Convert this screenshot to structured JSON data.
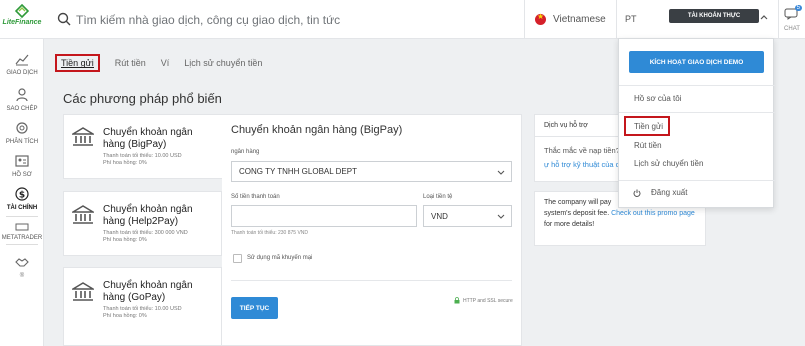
{
  "brand": {
    "name": "LiteFinance",
    "color": "#2f9a3a"
  },
  "search": {
    "placeholder": "Tìm kiếm nhà giao dịch, công cụ giao dịch, tin tức"
  },
  "header": {
    "language": "Vietnamese",
    "user_initials": "PT",
    "account_type": "TÀI KHOẢN THỰC",
    "chat_label": "CHAT",
    "chat_badge": "5"
  },
  "sidebar": {
    "items": [
      {
        "label": "GIAO DỊCH",
        "icon": "chart-icon"
      },
      {
        "label": "SAO CHÉP",
        "icon": "copy-trader-icon"
      },
      {
        "label": "PHÂN TÍCH",
        "icon": "analysis-icon"
      },
      {
        "label": "HỒ SƠ",
        "icon": "profile-icon"
      },
      {
        "label": "TÀI CHÍNH",
        "icon": "dollar-icon"
      },
      {
        "label": "METATRADER",
        "icon": "metatrader-icon"
      },
      {
        "label": "",
        "icon": "handshake-icon"
      }
    ]
  },
  "tabs": [
    {
      "label": "Tiền gửi",
      "active": true
    },
    {
      "label": "Rút tiền",
      "active": false
    },
    {
      "label": "Ví",
      "active": false
    },
    {
      "label": "Lịch sử chuyển tiền",
      "active": false
    }
  ],
  "section_title": "Các phương pháp phổ biến",
  "methods": [
    {
      "name": "Chuyển khoản ngân hàng (BigPay)",
      "min": "Thanh toán tối thiểu: 10.00 USD",
      "fee": "Phí hoa hồng: 0%"
    },
    {
      "name": "Chuyển khoản ngân hàng (Help2Pay)",
      "min": "Thanh toán tối thiểu: 300 000 VND",
      "fee": "Phí hoa hồng: 0%"
    },
    {
      "name": "Chuyển khoản ngân hàng (GoPay)",
      "min": "Thanh toán tối thiểu: 10.00 USD",
      "fee": "Phí hoa hồng: 0%"
    }
  ],
  "form": {
    "title": "Chuyển khoản ngân hàng (BigPay)",
    "bank_label": "ngân hàng",
    "bank_value": "CONG TY TNHH GLOBAL DEPT",
    "amount_label": "Số tiền thanh toán",
    "amount_value": "",
    "amount_hint": "Thanh toán tối thiểu: 230 875 VND",
    "currency_label": "Loại tiền tệ",
    "currency_value": "VND",
    "promo_label": "Sử dụng mã khuyến mại",
    "continue_label": "TIẾP TỤC",
    "secure_label": "HTTP and SSL secure"
  },
  "support": {
    "title": "Dịch vụ hỗ trợ",
    "question": "Thắc mắc về nạp tiền?",
    "link": "ự hỗ trợ kỹ thuật của chún"
  },
  "promo": {
    "text_before": "The company will pay",
    "text_mid": "system's deposit fee.",
    "link_text": "Check out this promo page",
    "text_after": "for more details!"
  },
  "dropdown": {
    "demo_button": "KÍCH HOẠT GIAO DỊCH DEMO",
    "profile": "Hồ sơ của tôi",
    "deposit": "Tiền gửi",
    "withdraw": "Rút tiền",
    "history": "Lịch sử chuyển tiền",
    "logout": "Đăng xuất"
  },
  "colors": {
    "accent": "#2f8ad6",
    "highlight": "#c4161c"
  }
}
